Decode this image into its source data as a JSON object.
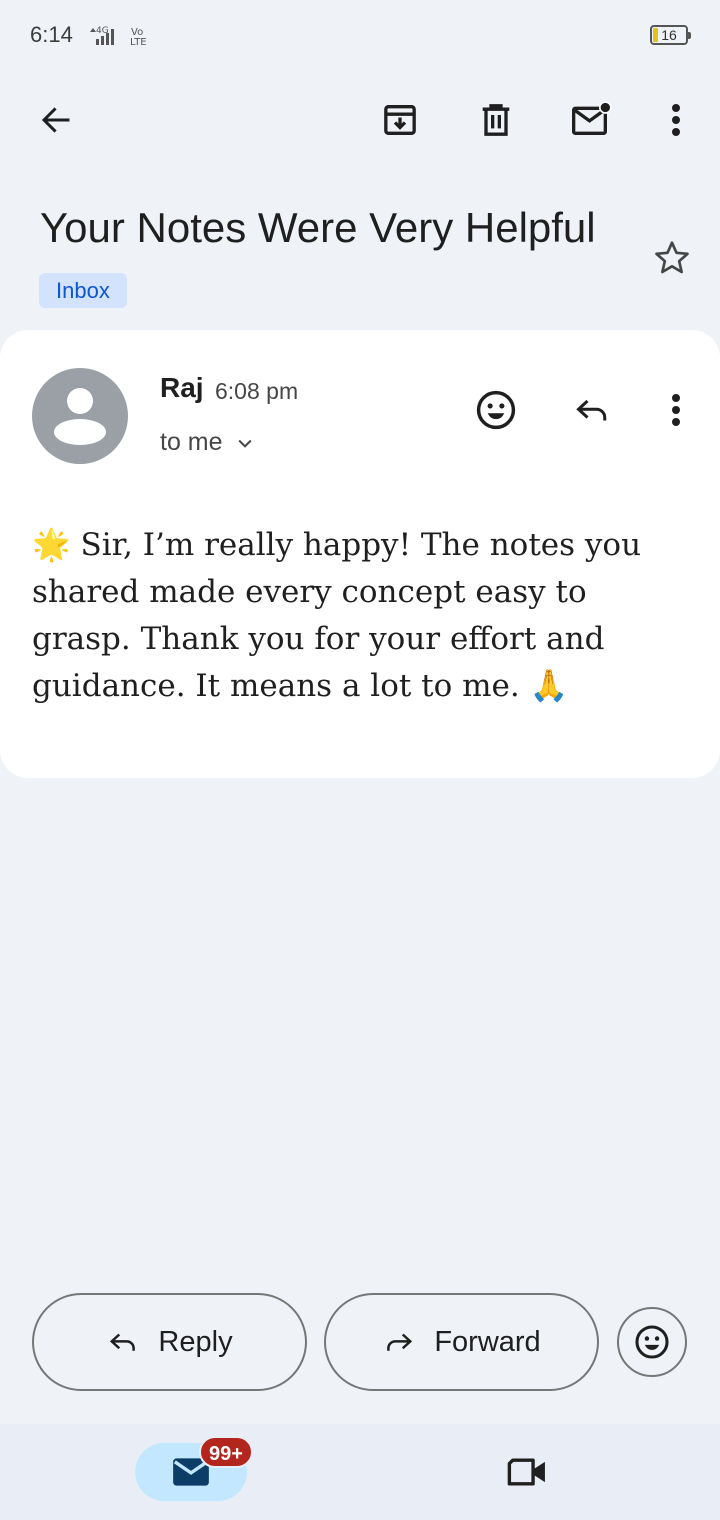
{
  "status_bar": {
    "time": "6:14",
    "network": "4G",
    "volte": "Vo LTE",
    "battery": "16"
  },
  "toolbar": {
    "back_icon": "arrow-left-icon",
    "archive_icon": "archive-icon",
    "delete_icon": "trash-icon",
    "mark_unread_icon": "mail-unread-icon",
    "more_icon": "more-vert-icon"
  },
  "email": {
    "subject": "Your Notes Were Very Helpful",
    "label": "Inbox",
    "starred": false,
    "sender": "Raj",
    "time": "6:08 pm",
    "recipient": "to me",
    "body": "🌟 Sir, I’m really happy! The notes you shared made every concept easy to grasp. Thank you for your effort and guidance. It means a lot to me. 🙏"
  },
  "actions": {
    "reply": "Reply",
    "forward": "Forward"
  },
  "bottom_nav": {
    "mail_badge": "99+",
    "mail_icon": "mail-icon",
    "meet_icon": "video-icon"
  },
  "colors": {
    "background": "#eff3f8",
    "card": "#ffffff",
    "chip_bg": "#d3e3fd",
    "chip_text": "#0b57d0",
    "badge": "#b3261e",
    "active_tab": "#c2e7ff"
  }
}
